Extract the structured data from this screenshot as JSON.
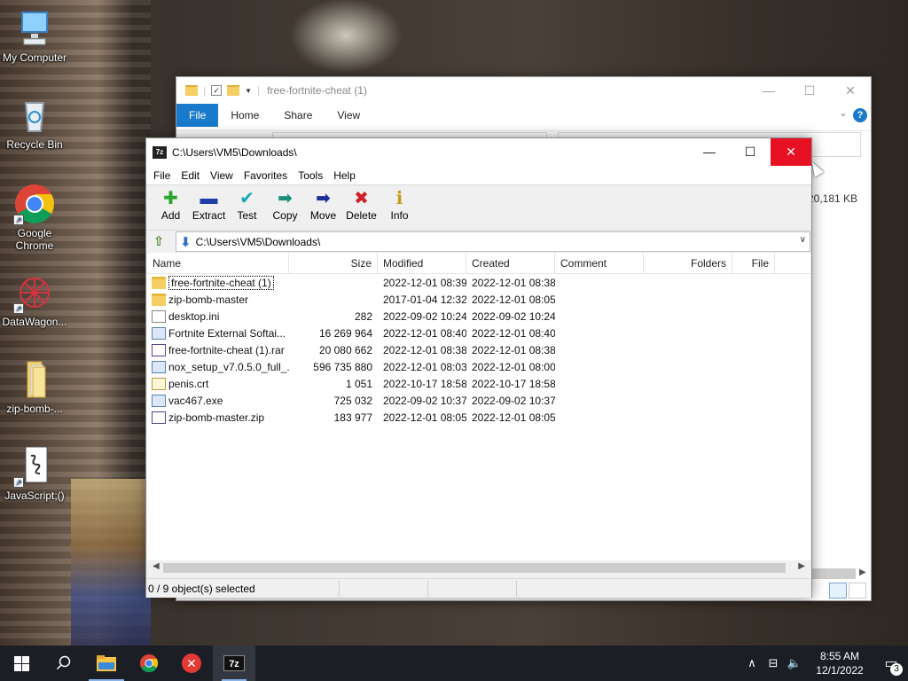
{
  "desktop": {
    "icons": [
      {
        "label": "My Computer",
        "icon": "computer-icon"
      },
      {
        "label": "Recycle Bin",
        "icon": "recycle-bin-icon"
      },
      {
        "label": "Google Chrome",
        "icon": "chrome-icon"
      },
      {
        "label": "DataWagon...",
        "icon": "datawagon-icon"
      },
      {
        "label": "zip-bomb-...",
        "icon": "folder-icon"
      },
      {
        "label": "JavaScript;()",
        "icon": "script-icon"
      }
    ]
  },
  "explorer": {
    "title": "free-fortnite-cheat (1)",
    "tabs": [
      "File",
      "Home",
      "Share",
      "View"
    ],
    "visible_size": "20,181 KB",
    "help": "?"
  },
  "zip": {
    "title": "C:\\Users\\VM5\\Downloads\\",
    "icon_text": "7z",
    "menu": [
      "File",
      "Edit",
      "View",
      "Favorites",
      "Tools",
      "Help"
    ],
    "toolbar": [
      {
        "label": "Add",
        "glyph": "✚",
        "color": "#2aa52a"
      },
      {
        "label": "Extract",
        "glyph": "▬",
        "color": "#1f3fa8"
      },
      {
        "label": "Test",
        "glyph": "✔",
        "color": "#16a6b8"
      },
      {
        "label": "Copy",
        "glyph": "➡",
        "color": "#1b8f7a"
      },
      {
        "label": "Move",
        "glyph": "➡",
        "color": "#1c2f9a"
      },
      {
        "label": "Delete",
        "glyph": "✖",
        "color": "#d0202a"
      },
      {
        "label": "Info",
        "glyph": "ℹ",
        "color": "#c89a18"
      }
    ],
    "path": "C:\\Users\\VM5\\Downloads\\",
    "columns": [
      "Name",
      "Size",
      "Modified",
      "Created",
      "Comment",
      "Folders",
      "File"
    ],
    "rows": [
      {
        "name": "free-fortnite-cheat (1)",
        "size": "",
        "modified": "2022-12-01 08:39",
        "created": "2022-12-01 08:38",
        "type": "folder"
      },
      {
        "name": "zip-bomb-master",
        "size": "",
        "modified": "2017-01-04 12:32",
        "created": "2022-12-01 08:05",
        "type": "folder"
      },
      {
        "name": "desktop.ini",
        "size": "282",
        "modified": "2022-09-02 10:24",
        "created": "2022-09-02 10:24",
        "type": "file"
      },
      {
        "name": "Fortnite External Softai...",
        "size": "16 269 964",
        "modified": "2022-12-01 08:40",
        "created": "2022-12-01 08:40",
        "type": "exe"
      },
      {
        "name": "free-fortnite-cheat (1).rar",
        "size": "20 080 662",
        "modified": "2022-12-01 08:38",
        "created": "2022-12-01 08:38",
        "type": "rar"
      },
      {
        "name": "nox_setup_v7.0.5.0_full_...",
        "size": "596 735 880",
        "modified": "2022-12-01 08:03",
        "created": "2022-12-01 08:00",
        "type": "exe"
      },
      {
        "name": "penis.crt",
        "size": "1 051",
        "modified": "2022-10-17 18:58",
        "created": "2022-10-17 18:58",
        "type": "crt"
      },
      {
        "name": "vac467.exe",
        "size": "725 032",
        "modified": "2022-09-02 10:37",
        "created": "2022-09-02 10:37",
        "type": "exe"
      },
      {
        "name": "zip-bomb-master.zip",
        "size": "183 977",
        "modified": "2022-12-01 08:05",
        "created": "2022-12-01 08:05",
        "type": "zip"
      }
    ],
    "status": "0 / 9 object(s) selected"
  },
  "taskbar": {
    "time": "8:55 AM",
    "date": "12/1/2022",
    "notifications": "3",
    "app_7z": "7z"
  }
}
